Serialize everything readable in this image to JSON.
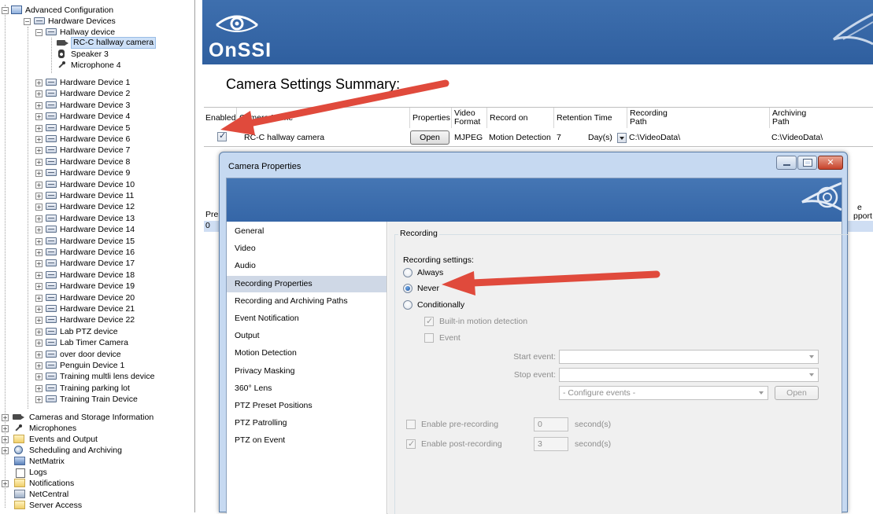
{
  "tree": {
    "root": "Advanced Configuration",
    "hardware_devices": "Hardware Devices",
    "hallway_device": "Hallway device",
    "hallway_children": [
      "RC-C hallway camera",
      "Speaker 3",
      "Microphone 4"
    ],
    "devices": [
      "Hardware Device 1",
      "Hardware Device 2",
      "Hardware Device 3",
      "Hardware Device 4",
      "Hardware Device 5",
      "Hardware Device 6",
      "Hardware Device 7",
      "Hardware Device 8",
      "Hardware Device 9",
      "Hardware Device 10",
      "Hardware Device 11",
      "Hardware Device 12",
      "Hardware Device 13",
      "Hardware Device 14",
      "Hardware Device 15",
      "Hardware Device 16",
      "Hardware Device 17",
      "Hardware Device 18",
      "Hardware Device 19",
      "Hardware Device 20",
      "Hardware Device 21",
      "Hardware Device 22",
      "Lab PTZ device",
      "Lab Timer Camera",
      "over door device",
      "Penguin Device 1",
      "Training multli lens device",
      "Training parking lot",
      "Training Train Device"
    ],
    "top_level": [
      "Cameras and Storage Information",
      "Microphones",
      "Events and Output",
      "Scheduling and Archiving",
      "NetMatrix",
      "Logs",
      "Notifications",
      "NetCentral",
      "Server Access"
    ]
  },
  "banner": {
    "logo_text": "OnSSI"
  },
  "summary": {
    "title": "Camera Settings Summary:",
    "headers": {
      "enabled": "Enabled",
      "camera_name": "Camera Name",
      "properties": "Properties",
      "video_format_1": "Video",
      "video_format_2": "Format",
      "record_on": "Record on",
      "retention_time": "Retention Time",
      "recording_path_1": "Recording",
      "recording_path_2": "Path",
      "archiving_path_1": "Archiving",
      "archiving_path_2": "Path"
    },
    "row": {
      "enabled": true,
      "camera_name": "RC-C hallway camera",
      "properties_button": "Open",
      "video_format": "MJPEG",
      "record_on": "Motion Detection",
      "retention_value": "7",
      "retention_unit": "Day(s)",
      "recording_path": "C:\\VideoData\\",
      "archiving_path": "C:\\VideoData\\"
    },
    "background_table": {
      "header_left": "Pres",
      "header_right_1": "e",
      "header_right_2": "pport",
      "row_value": "0"
    }
  },
  "dialog": {
    "title": "Camera Properties",
    "nav": [
      "General",
      "Video",
      "Audio",
      "Recording Properties",
      "Recording and Archiving Paths",
      "Event Notification",
      "Output",
      "Motion Detection",
      "Privacy Masking",
      "360° Lens",
      "PTZ Preset Positions",
      "PTZ Patrolling",
      "PTZ on Event"
    ],
    "selected_nav": "Recording Properties",
    "recording": {
      "group_title": "Recording",
      "settings_label": "Recording settings:",
      "options": [
        "Always",
        "Never",
        "Conditionally"
      ],
      "selected": "Never",
      "builtin_motion": "Built-in motion detection",
      "builtin_motion_checked": true,
      "event": "Event",
      "event_checked": false,
      "start_event_label": "Start event:",
      "stop_event_label": "Stop event:",
      "start_event_value": "",
      "stop_event_value": "",
      "configure_events": "- Configure events -",
      "open_button": "Open",
      "pre_recording_label": "Enable pre-recording",
      "pre_recording_checked": false,
      "pre_recording_value": "0",
      "post_recording_label": "Enable post-recording",
      "post_recording_checked": true,
      "post_recording_value": "3",
      "seconds_unit": "second(s)"
    }
  },
  "colors": {
    "banner_blue": "#3566a7",
    "dialog_frame": "#c6d9f1",
    "selection": "#cfd8e6",
    "annotation_arrow": "#e04a3c"
  }
}
